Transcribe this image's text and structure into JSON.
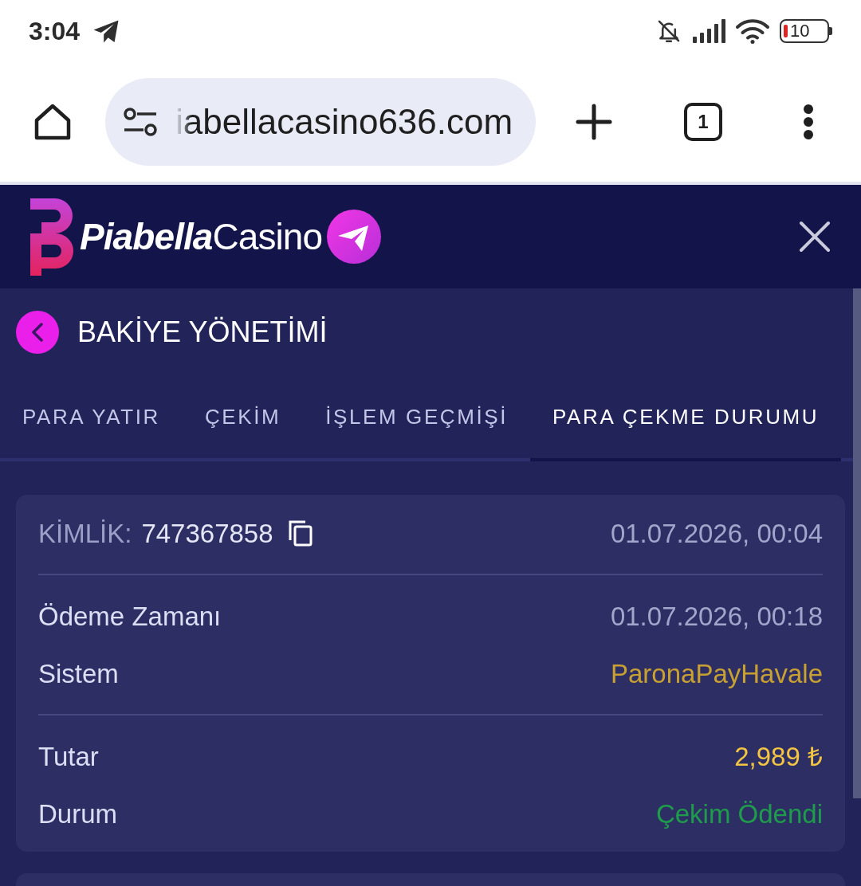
{
  "status_bar": {
    "time": "3:04",
    "battery": "10"
  },
  "browser": {
    "url": "iabellacasino636.com",
    "tab_count": "1"
  },
  "site_header": {
    "logo": {
      "strong": "Piabella",
      "light": "Casino"
    }
  },
  "page": {
    "title": "BAKİYE YÖNETİMİ"
  },
  "tabs": [
    {
      "label": "PARA YATIR",
      "selected": false
    },
    {
      "label": "ÇEKİM",
      "selected": false
    },
    {
      "label": "İŞLEM GEÇMİŞİ",
      "selected": false
    },
    {
      "label": "PARA ÇEKME DURUMU",
      "selected": true
    }
  ],
  "withdrawal": {
    "id_label": "KİMLİK:",
    "id": "747367858",
    "created": "01.07.2026, 00:04",
    "sections": [
      {
        "rows": [
          {
            "label": "Ödeme Zamanı",
            "value": "01.07.2026, 00:18",
            "kind": "time"
          },
          {
            "label": "Sistem",
            "value": "ParonaPayHavale",
            "kind": "system"
          }
        ]
      },
      {
        "rows": [
          {
            "label": "Tutar",
            "value": "2,989 ₺",
            "kind": "amount"
          },
          {
            "label": "Durum",
            "value": "Çekim Ödendi",
            "kind": "status"
          }
        ]
      }
    ]
  }
}
